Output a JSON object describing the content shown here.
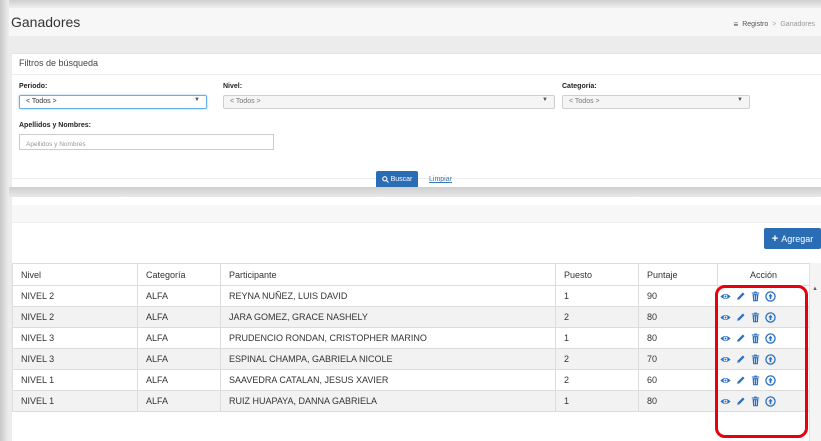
{
  "header": {
    "title": "Ganadores",
    "breadcrumb": [
      "Registro",
      "Ganadores"
    ]
  },
  "filters": {
    "title": "Filtros de búsqueda",
    "periodo": {
      "label": "Periodo:",
      "value": "< Todos >"
    },
    "nivel": {
      "label": "Nivel:",
      "value": "< Todos >"
    },
    "categoria": {
      "label": "Categoría:",
      "value": "< Todos >"
    },
    "nombres": {
      "label": "Apellidos y Nombres:",
      "placeholder": "Apellidos y Nombres"
    },
    "search_label": "Buscar",
    "clear_label": "Limpiar"
  },
  "results": {
    "add_label": "Agregar",
    "columns": [
      "Nivel",
      "Categoría",
      "Participante",
      "Puesto",
      "Puntaje",
      "Acción"
    ],
    "rows": [
      {
        "nivel": "NIVEL 2",
        "categoria": "ALFA",
        "participante": "REYNA NUÑEZ, LUIS DAVID",
        "puesto": "1",
        "puntaje": "90"
      },
      {
        "nivel": "NIVEL 2",
        "categoria": "ALFA",
        "participante": "JARA GOMEZ, GRACE NASHELY",
        "puesto": "2",
        "puntaje": "80"
      },
      {
        "nivel": "NIVEL 3",
        "categoria": "ALFA",
        "participante": "PRUDENCIO RONDAN, CRISTOPHER MARINO",
        "puesto": "1",
        "puntaje": "80"
      },
      {
        "nivel": "NIVEL 3",
        "categoria": "ALFA",
        "participante": "ESPINAL CHAMPA, GABRIELA NICOLE",
        "puesto": "2",
        "puntaje": "70"
      },
      {
        "nivel": "NIVEL 1",
        "categoria": "ALFA",
        "participante": "SAAVEDRA CATALAN, JESUS XAVIER",
        "puesto": "2",
        "puntaje": "60"
      },
      {
        "nivel": "NIVEL 1",
        "categoria": "ALFA",
        "participante": "RUIZ HUAPAYA, DANNA GABRIELA",
        "puesto": "1",
        "puntaje": "80"
      }
    ],
    "row_actions": [
      "eye-icon",
      "pencil-icon",
      "trash-icon",
      "upload-circle-icon"
    ]
  },
  "colors": {
    "primary": "#2a6db5",
    "icon": "#2b6fbf",
    "highlight": "#e8000b"
  }
}
